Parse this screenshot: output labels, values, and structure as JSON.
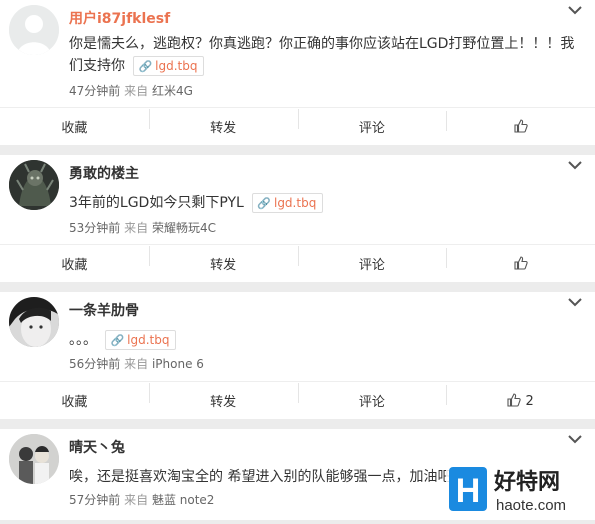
{
  "comments": [
    {
      "username": "用户i87jfklesf",
      "content": "你是懦夫么，逃跑权？你真逃跑？你正确的事你应该站在LGD打野位置上！！！我们支持你",
      "tag": "lgd.tbq",
      "time": "47分钟前",
      "from_label": "来自",
      "device": "红米4G",
      "like_count": ""
    },
    {
      "username": "勇敢的楼主",
      "content": "3年前的LGD如今只剩下PYL",
      "tag": "lgd.tbq",
      "time": "53分钟前",
      "from_label": "来自",
      "device": "荣耀畅玩4C",
      "like_count": ""
    },
    {
      "username": "一条羊肋骨",
      "content": "。。。",
      "tag": "lgd.tbq",
      "time": "56分钟前",
      "from_label": "来自",
      "device": "iPhone 6",
      "like_count": "2"
    },
    {
      "username": "晴天丶兔",
      "content": "唉，还是挺喜欢淘宝全的 希望进入别的队能够强一点，加油吧",
      "tag": "",
      "time": "57分钟前",
      "from_label": "来自",
      "device": "魅蓝 note2",
      "like_count": ""
    }
  ],
  "actions": {
    "favorite": "收藏",
    "repost": "转发",
    "comment": "评论"
  },
  "watermark": {
    "logo_letter": "H",
    "brand": "好特网",
    "url": "haote.com"
  },
  "colors": {
    "username_highlight": "#eb7350",
    "watermark_blue": "#1a8ae0"
  }
}
